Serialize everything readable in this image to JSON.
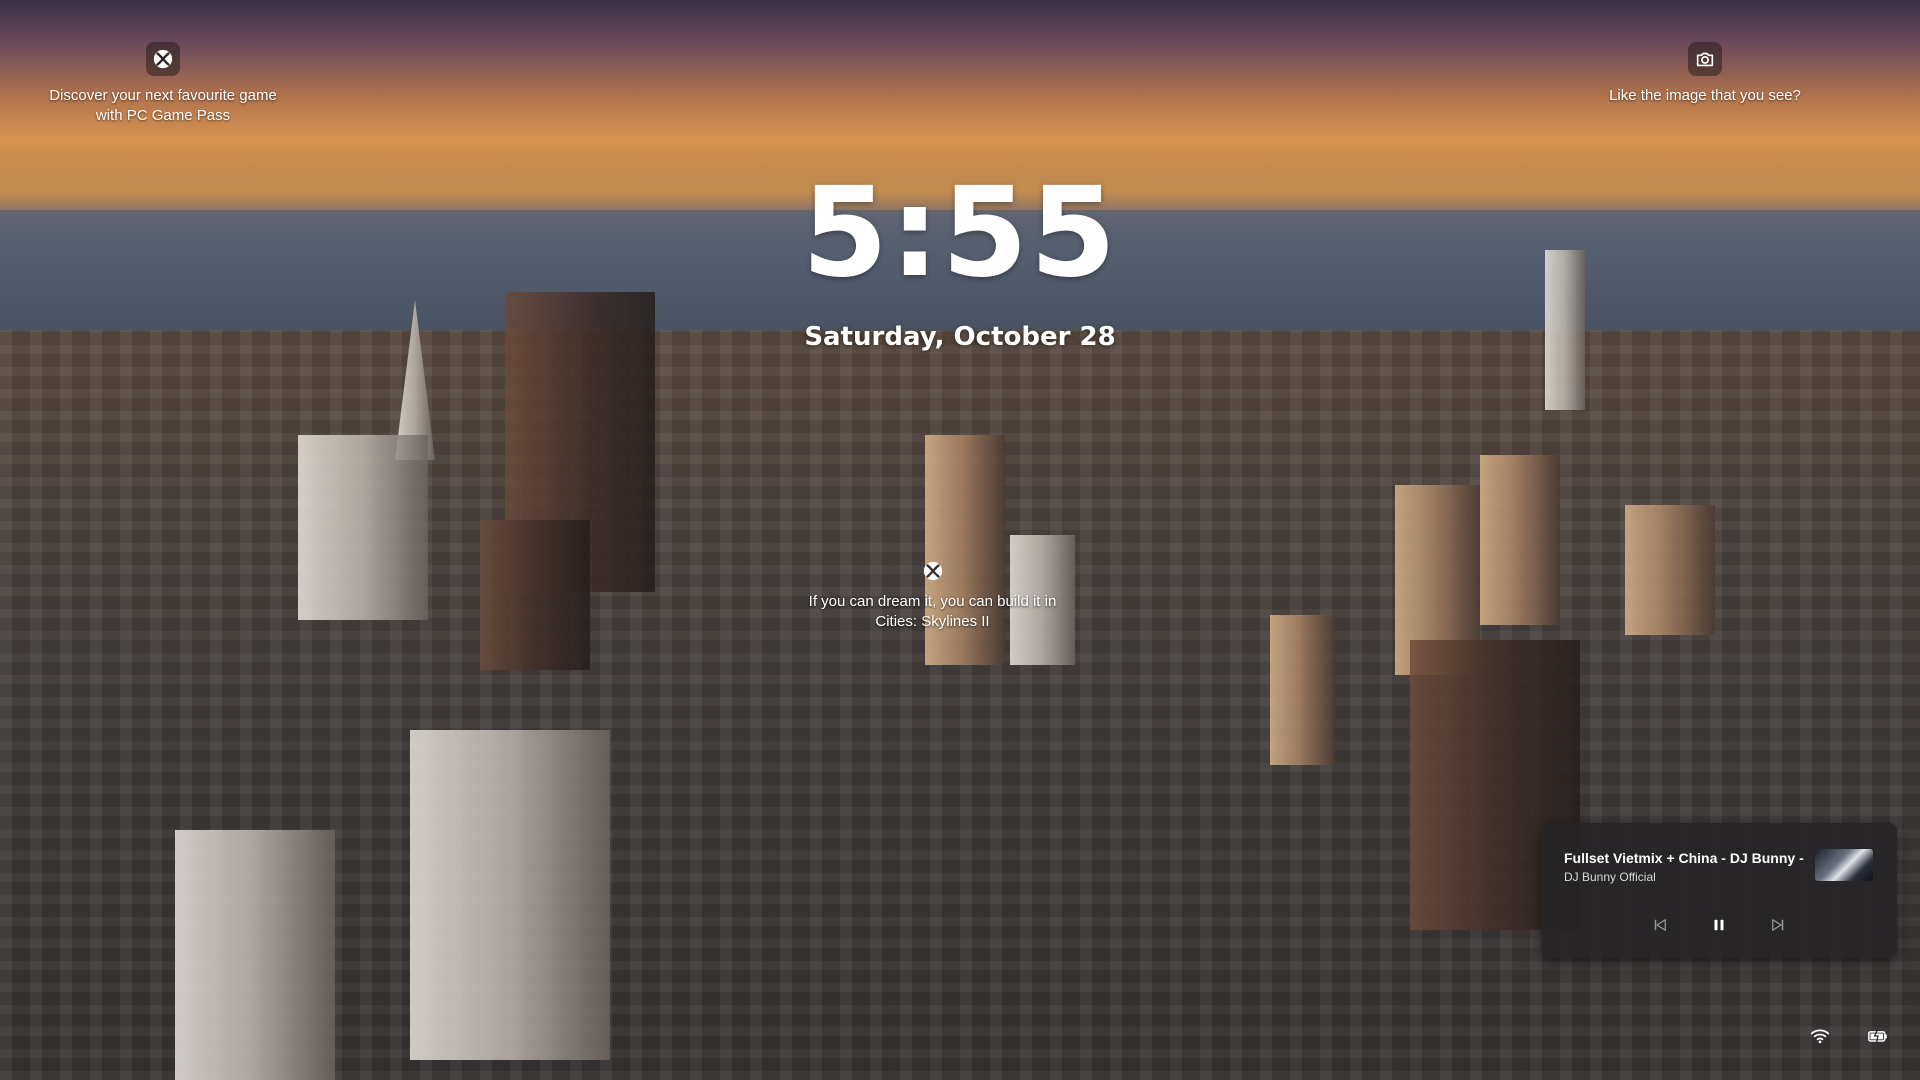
{
  "lock_screen": {
    "time": "5:55",
    "date": "Saturday, October 28"
  },
  "widgets": {
    "game_pass": {
      "icon": "xbox-icon",
      "line1": "Discover your next favourite game",
      "line2": "with PC Game Pass"
    },
    "spotlight": {
      "icon": "camera-icon",
      "text": "Like the image that you see?"
    },
    "game_promo": {
      "icon": "xbox-icon",
      "line1": "If you can dream it, you can build it in",
      "line2": "Cities: Skylines II"
    }
  },
  "media_player": {
    "title": "Fullset Vietmix + China - DJ Bunny -...",
    "artist": "DJ Bunny Official",
    "controls": {
      "previous_icon": "previous-track-icon",
      "pause_icon": "pause-icon",
      "next_icon": "next-track-icon"
    }
  },
  "system_tray": {
    "wifi_icon": "wifi-icon",
    "battery_icon": "battery-charging-icon"
  },
  "colors": {
    "text": "#ffffff",
    "media_bg": "#262426"
  }
}
